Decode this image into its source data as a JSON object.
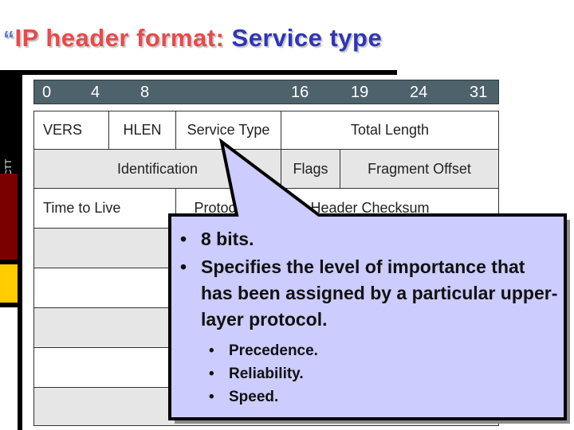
{
  "slide": {
    "title_bullet": "“",
    "title_part1": "IP header format: ",
    "title_part2": "Service type",
    "sidebar_label": "The Saigon CTT"
  },
  "colors": {
    "title_red": "#e84a4a",
    "title_blue": "#2f36b8",
    "header_bar": "#4e626b",
    "callout_fill": "#ccccff",
    "sidebar_red": "#7a0000",
    "sidebar_yellow": "#ffcc00"
  },
  "bit_ruler": [
    "0",
    "4",
    "8",
    "16",
    "19",
    "24",
    "31"
  ],
  "table": {
    "rows": [
      {
        "shade": "white",
        "cells": [
          "VERS",
          "HLEN",
          "Service Type",
          "Total Length"
        ]
      },
      {
        "shade": "gray",
        "cells": [
          "Identification",
          "Flags",
          "Fragment  Offset"
        ]
      },
      {
        "shade": "white",
        "cells": [
          "Time to Live",
          "Protocol",
          "Header Checksum"
        ]
      },
      {
        "shade": "gray",
        "cells": []
      },
      {
        "shade": "white",
        "cells": []
      },
      {
        "shade": "gray",
        "cells": []
      },
      {
        "shade": "white",
        "cells": []
      },
      {
        "shade": "gray",
        "cells": []
      }
    ]
  },
  "callout": {
    "points_to": "Service Type",
    "bullets": [
      "8 bits.",
      "Specifies the level of importance that has been assigned by a particular upper-layer protocol."
    ],
    "sub_bullets": [
      "Precedence.",
      "Reliability.",
      "Speed."
    ]
  }
}
